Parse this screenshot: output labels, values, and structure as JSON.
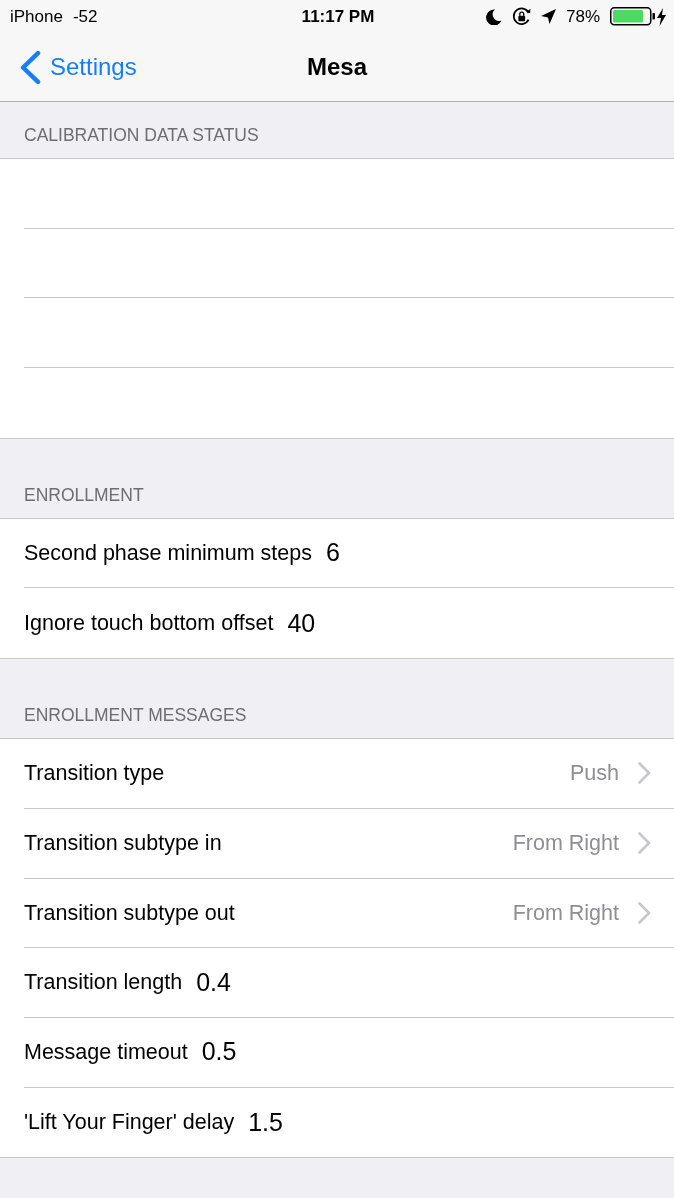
{
  "status_bar": {
    "carrier": "iPhone",
    "signal": "-52",
    "time": "11:17 PM",
    "battery_percent": "78%"
  },
  "nav_bar": {
    "back_label": "Settings",
    "title": "Mesa"
  },
  "sections": [
    {
      "header": "CALIBRATION DATA STATUS",
      "rows": [
        {
          "kind": "blank"
        },
        {
          "kind": "blank"
        },
        {
          "kind": "blank"
        },
        {
          "kind": "blank"
        }
      ]
    },
    {
      "header": "ENROLLMENT",
      "rows": [
        {
          "kind": "text_field",
          "label": "Second phase minimum steps",
          "value": "6"
        },
        {
          "kind": "text_field",
          "label": "Ignore touch bottom offset",
          "value": "40"
        }
      ]
    },
    {
      "header": "ENROLLMENT MESSAGES",
      "rows": [
        {
          "kind": "disclosure",
          "label": "Transition type",
          "value": "Push"
        },
        {
          "kind": "disclosure",
          "label": "Transition subtype in",
          "value": "From Right"
        },
        {
          "kind": "disclosure",
          "label": "Transition subtype out",
          "value": "From Right"
        },
        {
          "kind": "text_field",
          "label": "Transition length",
          "value": "0.4"
        },
        {
          "kind": "text_field",
          "label": "Message timeout",
          "value": "0.5"
        },
        {
          "kind": "text_field",
          "label": "'Lift Your Finger' delay",
          "value": "1.5"
        }
      ]
    }
  ]
}
